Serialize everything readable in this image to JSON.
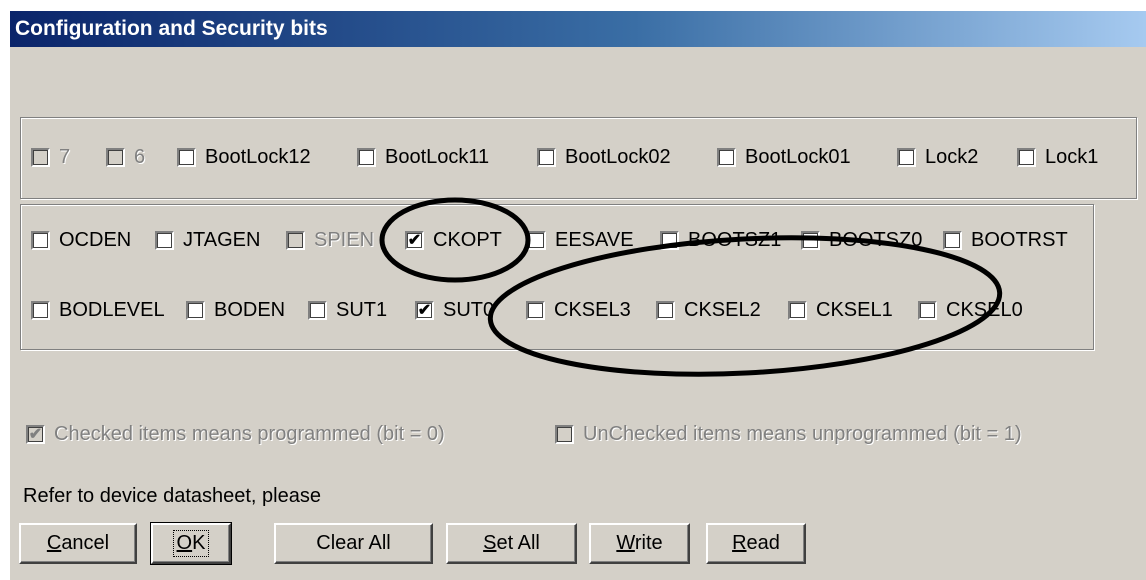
{
  "window": {
    "title": "Configuration and Security bits"
  },
  "lock_bits": [
    {
      "label": "7",
      "checked": false,
      "enabled": false
    },
    {
      "label": "6",
      "checked": false,
      "enabled": false
    },
    {
      "label": "BootLock12",
      "checked": false,
      "enabled": true
    },
    {
      "label": "BootLock11",
      "checked": false,
      "enabled": true
    },
    {
      "label": "BootLock02",
      "checked": false,
      "enabled": true
    },
    {
      "label": "BootLock01",
      "checked": false,
      "enabled": true
    },
    {
      "label": "Lock2",
      "checked": false,
      "enabled": true
    },
    {
      "label": "Lock1",
      "checked": false,
      "enabled": true
    }
  ],
  "fuse_high": [
    {
      "label": "OCDEN",
      "checked": false,
      "enabled": true
    },
    {
      "label": "JTAGEN",
      "checked": false,
      "enabled": true
    },
    {
      "label": "SPIEN",
      "checked": false,
      "enabled": false
    },
    {
      "label": "CKOPT",
      "checked": true,
      "enabled": true
    },
    {
      "label": "EESAVE",
      "checked": false,
      "enabled": true
    },
    {
      "label": "BOOTSZ1",
      "checked": false,
      "enabled": true
    },
    {
      "label": "BOOTSZ0",
      "checked": false,
      "enabled": true
    },
    {
      "label": "BOOTRST",
      "checked": false,
      "enabled": true
    }
  ],
  "fuse_low": [
    {
      "label": "BODLEVEL",
      "checked": false,
      "enabled": true
    },
    {
      "label": "BODEN",
      "checked": false,
      "enabled": true
    },
    {
      "label": "SUT1",
      "checked": false,
      "enabled": true
    },
    {
      "label": "SUT0",
      "checked": true,
      "enabled": true
    },
    {
      "label": "CKSEL3",
      "checked": false,
      "enabled": true
    },
    {
      "label": "CKSEL2",
      "checked": false,
      "enabled": true
    },
    {
      "label": "CKSEL1",
      "checked": false,
      "enabled": true
    },
    {
      "label": "CKSEL0",
      "checked": false,
      "enabled": true
    }
  ],
  "legend": {
    "checked": {
      "label": "Checked items means programmed (bit = 0)",
      "checked": true,
      "enabled": false
    },
    "unchecked": {
      "label": "UnChecked items means unprogrammed (bit = 1)",
      "checked": false,
      "enabled": false
    }
  },
  "note": "Refer to device datasheet, please",
  "buttons": {
    "cancel": {
      "mnemonic": "C",
      "rest": "ancel"
    },
    "ok": {
      "mnemonic": "O",
      "rest": "K"
    },
    "clear_all": {
      "mnemonic": "",
      "rest": "Clear All"
    },
    "set_all": {
      "mnemonic": "S",
      "rest": "et All"
    },
    "write": {
      "mnemonic": "W",
      "rest": "rite"
    },
    "read": {
      "mnemonic": "R",
      "rest": "ead"
    }
  },
  "colors": {
    "face": "#d4d0c8",
    "title_start": "#0a246a",
    "title_end": "#a6caf0",
    "disabled_text": "#808080"
  },
  "check_glyph": "✔"
}
